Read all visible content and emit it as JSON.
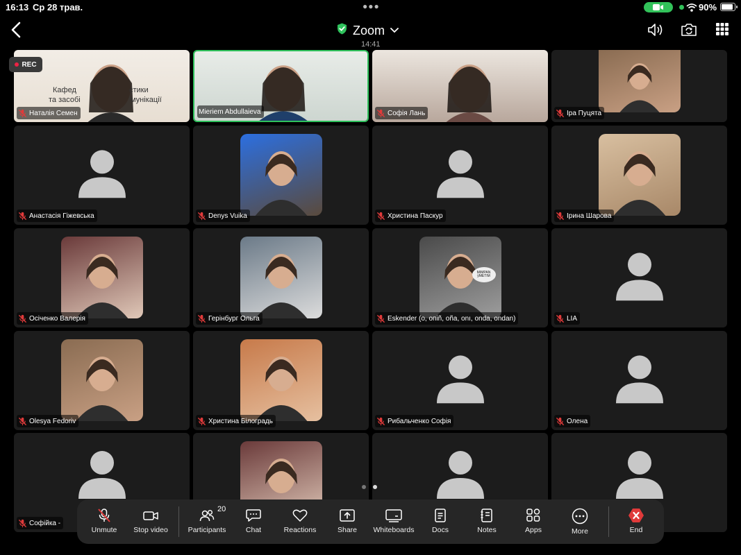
{
  "status_bar": {
    "time": "16:13",
    "date": "Ср 28 трав.",
    "battery": "90%",
    "battery_level": 0.9,
    "icons": [
      "camera-in-use-icon",
      "wifi-icon",
      "battery-icon"
    ]
  },
  "nav": {
    "title": "Zoom",
    "elapsed": "14:41",
    "icons": [
      "back-icon",
      "shield-check-icon",
      "chevron-down-icon",
      "speaker-icon",
      "switch-camera-icon",
      "grid-view-icon"
    ]
  },
  "recording": {
    "label": "REC"
  },
  "colors": {
    "active_speaker": "#2fc25c",
    "muted_mic": "#e03a3a",
    "end_red": "#e03a3a"
  },
  "participants": [
    {
      "name": "Наталія Семен",
      "video": true,
      "muted": true,
      "wall_text": [
        "Кафед",
        "стики",
        "та засобі",
        "мунікації"
      ]
    },
    {
      "name": "Mieriem Abdullaieva",
      "video": true,
      "muted": false,
      "active": true
    },
    {
      "name": "Софія Лань",
      "video": true,
      "muted": true
    },
    {
      "name": "Іра Пуцята",
      "video": false,
      "photo": true,
      "muted": true
    },
    {
      "name": "Анастасія Гіжевська",
      "video": false,
      "muted": true
    },
    {
      "name": "Denys Vuika",
      "video": false,
      "photo": true,
      "muted": true
    },
    {
      "name": "Христина Паскур",
      "video": false,
      "muted": true
    },
    {
      "name": "Ірина Шарова",
      "video": false,
      "photo": true,
      "muted": true
    },
    {
      "name": "Осіченко Валерія",
      "video": false,
      "photo": true,
      "muted": true
    },
    {
      "name": "Герінбург Ольга",
      "video": false,
      "photo": true,
      "muted": true
    },
    {
      "name": "Eskender (o, oпiñ, oña, onı, onda, ondan)",
      "video": false,
      "photo": true,
      "muted": true,
      "bubble_text": [
        "MIMPAN",
        "ÿMETIM"
      ]
    },
    {
      "name": "LIA",
      "video": false,
      "muted": true
    },
    {
      "name": "Olesya Fedoriv",
      "video": false,
      "photo": true,
      "muted": true
    },
    {
      "name": "Христина Білоградь",
      "video": false,
      "photo": true,
      "muted": true
    },
    {
      "name": "Рибальченко Софія",
      "video": false,
      "muted": true
    },
    {
      "name": "Олена",
      "video": false,
      "muted": true
    },
    {
      "name": "Софійка -",
      "video": false,
      "muted": true
    },
    {
      "name": "",
      "video": false,
      "photo": true,
      "muted": true
    },
    {
      "name": "",
      "video": false,
      "muted": true
    },
    {
      "name": "",
      "video": false,
      "muted": true
    }
  ],
  "pager": {
    "pages": 2,
    "current": 2
  },
  "toolbar": {
    "unmute": "Unmute",
    "stop_video": "Stop video",
    "participants": "Participants",
    "participants_count": "20",
    "chat": "Chat",
    "reactions": "Reactions",
    "share": "Share",
    "whiteboards": "Whiteboards",
    "docs": "Docs",
    "notes": "Notes",
    "apps": "Apps",
    "more": "More",
    "end": "End"
  }
}
